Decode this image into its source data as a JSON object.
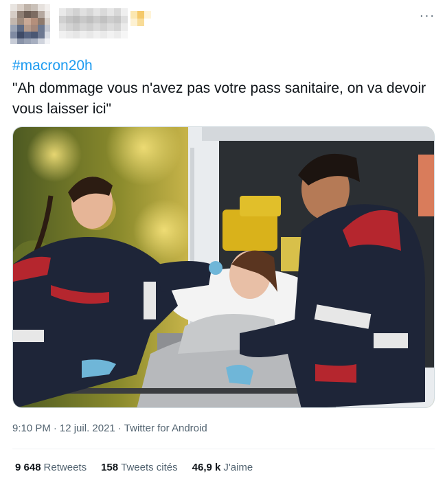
{
  "tweet": {
    "more_icon": "more-horizontal-icon",
    "hashtag": "#macron20h",
    "text": "\"Ah dommage vous n'avez pas votre pass sanitaire, on va devoir vous laisser ici\"",
    "time": "9:10 PM",
    "sep1": "·",
    "date": "12 juil. 2021",
    "sep2": "·",
    "source": "Twitter for Android",
    "stats": [
      {
        "value": "9 648",
        "label": "Retweets"
      },
      {
        "value": "158",
        "label": "Tweets cités"
      },
      {
        "value": "46,9 k",
        "label": "J'aime"
      }
    ]
  },
  "colors": {
    "link": "#1d9bf0",
    "text": "#0f1419",
    "muted": "#536471",
    "divider": "#eff3f4"
  }
}
